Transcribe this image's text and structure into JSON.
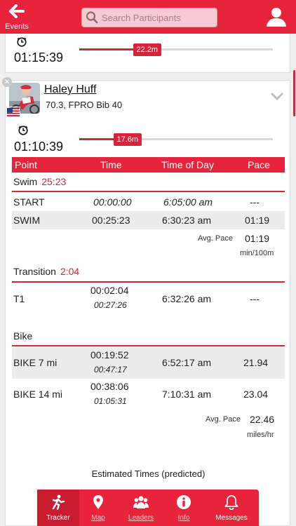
{
  "header": {
    "back_label": "Events",
    "search_placeholder": "Search Participants"
  },
  "card1": {
    "time": "01:15:39",
    "progress_label": "22.2m",
    "progress_fraction": 0.35
  },
  "athlete": {
    "name": "Haley Huff",
    "details": "70.3, FPRO Bib 40",
    "time": "01:10:39",
    "progress_label": "17.6m",
    "progress_fraction": 0.25
  },
  "table_header": {
    "point": "Point",
    "time": "Time",
    "time_of_day": "Time of Day",
    "pace": "Pace"
  },
  "swim": {
    "label": "Swim",
    "total": "25:23",
    "rows": [
      {
        "point": "START",
        "time": "00:00:00",
        "tod": "6:05:00 am",
        "pace": "---"
      },
      {
        "point": "SWIM",
        "time": "00:25:23",
        "tod": "6:30:23 am",
        "pace": "01:19"
      }
    ],
    "avg_label": "Avg. Pace",
    "avg_value": "01:19",
    "avg_unit": "min/100m"
  },
  "transition": {
    "label": "Transition",
    "total": "2:04",
    "rows": [
      {
        "point": "T1",
        "time": "00:02:04",
        "cum": "00:27:26",
        "tod": "6:32:26 am",
        "pace": "---"
      }
    ]
  },
  "bike": {
    "label": "Bike",
    "rows": [
      {
        "point": "BIKE 7 mi",
        "time": "00:19:52",
        "cum": "00:47:17",
        "tod": "6:52:17 am",
        "pace": "21.94"
      },
      {
        "point": "BIKE 14 mi",
        "time": "00:38:06",
        "cum": "01:05:31",
        "tod": "7:10:31 am",
        "pace": "23.04"
      }
    ],
    "avg_label": "Avg. Pace",
    "avg_value": "22.46",
    "avg_unit": "miles/hr"
  },
  "estimated_label": "Estimated Times (predicted)",
  "tabs": [
    {
      "label": "Tracker",
      "icon": "runner-icon"
    },
    {
      "label": "Map",
      "icon": "map-pin-icon"
    },
    {
      "label": "Leaders",
      "icon": "group-icon"
    },
    {
      "label": "Info",
      "icon": "info-icon"
    },
    {
      "label": "Messages",
      "icon": "bell-icon"
    }
  ],
  "colors": {
    "accent": "#e8243c",
    "accent_dark": "#d6243a"
  }
}
